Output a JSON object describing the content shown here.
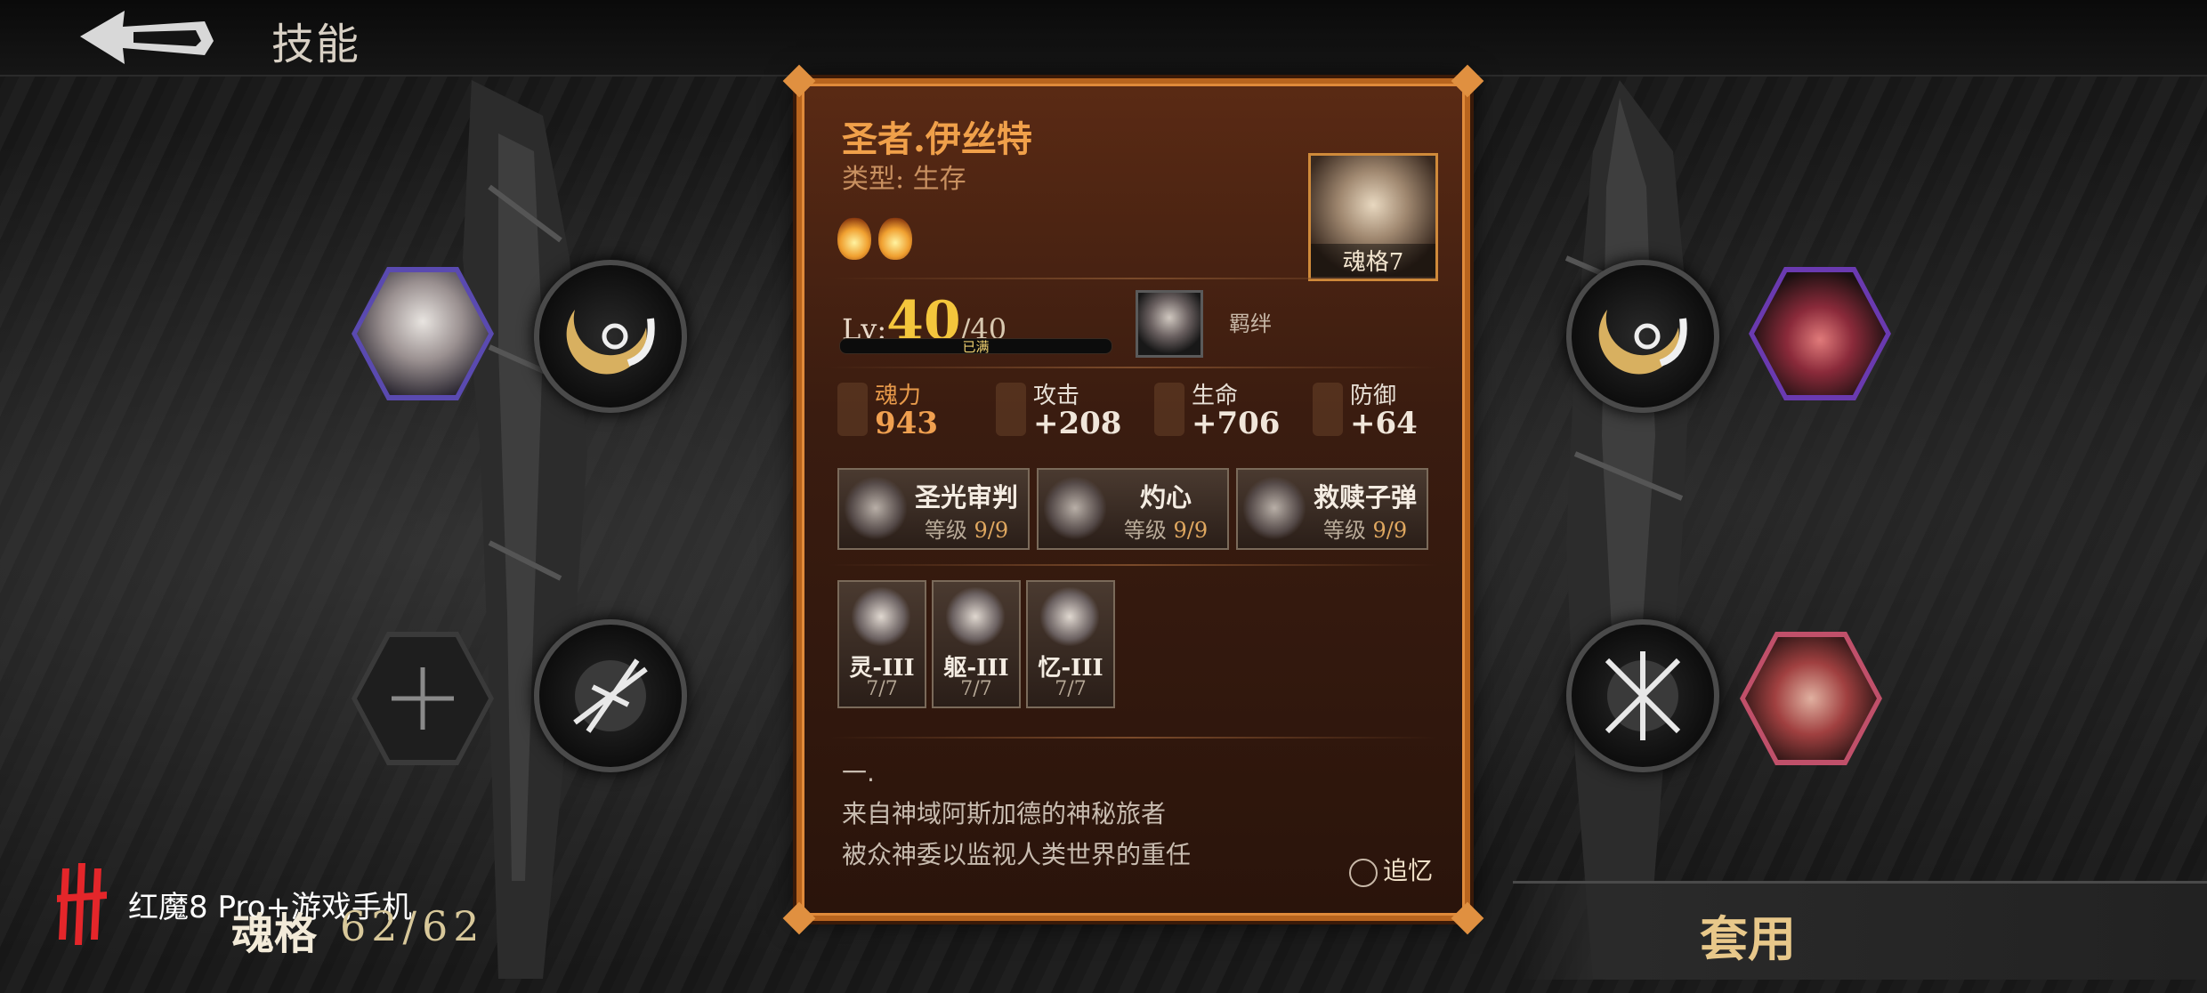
{
  "header": {
    "title": "技能"
  },
  "panel": {
    "name": "圣者.伊丝特",
    "type_label": "类型:",
    "type_value": "生存",
    "portrait_label": "魂格7",
    "level": {
      "prefix": "Lv:",
      "current": "40",
      "max": "/40",
      "bar_text": "已满",
      "progress": 1.0
    },
    "bond_label": "羁绊",
    "stats": [
      {
        "name": "魂力",
        "value": "943",
        "color": "#e89a4a"
      },
      {
        "name": "攻击",
        "value": "+208",
        "color": "#d8ccc0"
      },
      {
        "name": "生命",
        "value": "+706",
        "color": "#d8ccc0"
      },
      {
        "name": "防御",
        "value": "+64",
        "color": "#d8ccc0"
      }
    ],
    "skills": [
      {
        "name": "圣光审判",
        "level_label": "等级",
        "level": "9/9"
      },
      {
        "name": "灼心",
        "level_label": "等级",
        "level": "9/9"
      },
      {
        "name": "救赎子弹",
        "level_label": "等级",
        "level": "9/9"
      }
    ],
    "runes": [
      {
        "name": "灵-III",
        "count": "7/7"
      },
      {
        "name": "躯-III",
        "count": "7/7"
      },
      {
        "name": "忆-III",
        "count": "7/7"
      }
    ],
    "story": [
      "一.",
      "来自神域阿斯加德的神秘旅者",
      "被众神委以监视人类世界的重任"
    ],
    "recall_label": "追忆"
  },
  "footer": {
    "brand": "红魔8 Pro+游戏手机",
    "soul_label": "魂格",
    "soul_value": "62/62",
    "apply_label": "套用"
  },
  "icons": [
    "back-arrow-icon",
    "flame-icon",
    "plus-icon",
    "crescent-skill-icon",
    "burst-skill-icon",
    "recall-icon"
  ]
}
